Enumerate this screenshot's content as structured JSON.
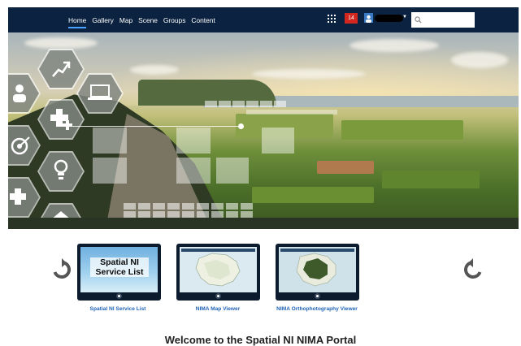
{
  "nav": {
    "items": [
      {
        "label": "Home",
        "active": true
      },
      {
        "label": "Gallery",
        "active": false
      },
      {
        "label": "Map",
        "active": false
      },
      {
        "label": "Scene",
        "active": false
      },
      {
        "label": "Groups",
        "active": false
      },
      {
        "label": "Content",
        "active": false
      }
    ],
    "notification_count": "14",
    "search": {
      "placeholder": "",
      "value": ""
    },
    "icons": [
      "apps-grid-icon",
      "user-avatar-icon",
      "chevron-down-icon",
      "search-icon"
    ]
  },
  "hero": {
    "icons": [
      "chart-growth-icon",
      "person-icon",
      "laptop-icon",
      "medical-plus-icon",
      "target-icon",
      "lightbulb-icon",
      "home-icon"
    ]
  },
  "gallery": {
    "prev_icon": "rotate-left-icon",
    "next_icon": "rotate-right-icon",
    "items": [
      {
        "thumb_text": "Spatial NI Service List",
        "caption": "Spatial NI Service List"
      },
      {
        "thumb_text": "",
        "caption": "NIMA Map Viewer"
      },
      {
        "thumb_text": "",
        "caption": "NIMA Orthophotography Viewer"
      }
    ]
  },
  "welcome": {
    "heading": "Welcome to the Spatial NI NIMA Portal"
  },
  "colors": {
    "nav_bg": "#0b2340",
    "nav_active": "#4aa3ff",
    "badge": "#d2271e",
    "caption_link": "#1f63b5"
  }
}
